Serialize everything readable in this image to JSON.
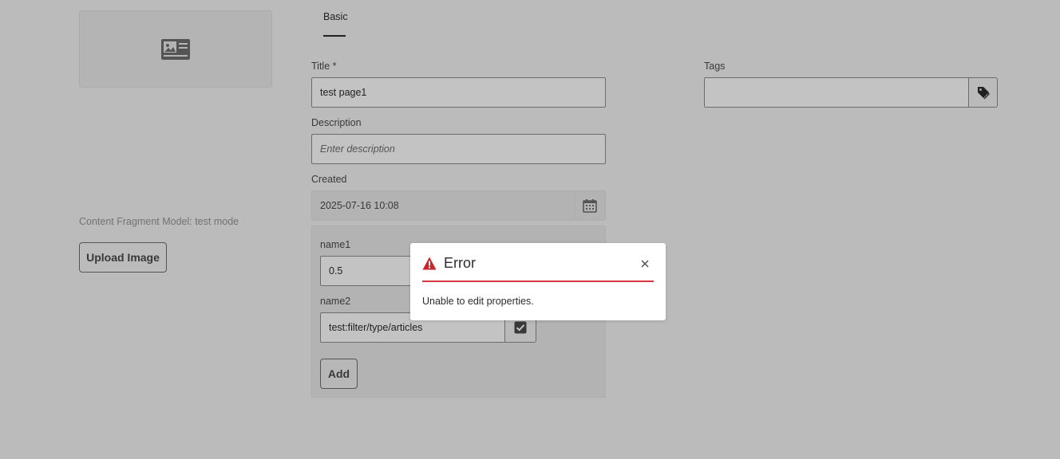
{
  "left_panel": {
    "thumbnail_icon": "image-placeholder-icon",
    "model_label": "Content Fragment Model: test mode",
    "upload_button": "Upload Image"
  },
  "tabs": [
    {
      "label": "Basic",
      "selected": true
    }
  ],
  "form": {
    "title": {
      "label": "Title *",
      "value": "test page1"
    },
    "description": {
      "label": "Description",
      "placeholder": "Enter description"
    },
    "created": {
      "label": "Created",
      "value": "2025-07-16 10:08",
      "icon": "calendar-icon"
    },
    "tags": {
      "label": "Tags",
      "value": "",
      "icon": "tag-icon"
    },
    "multifield": {
      "items": [
        {
          "label": "name1",
          "value": "0.5"
        },
        {
          "label": "name2",
          "value": "test:filter/type/articles",
          "icon": "checkbox-checked-icon"
        }
      ],
      "add_button": "Add"
    }
  },
  "dialog": {
    "title": "Error",
    "message": "Unable to edit properties.",
    "icon": "alert-triangle-icon",
    "close_icon": "close-icon",
    "accent_color": "#d7373f"
  }
}
